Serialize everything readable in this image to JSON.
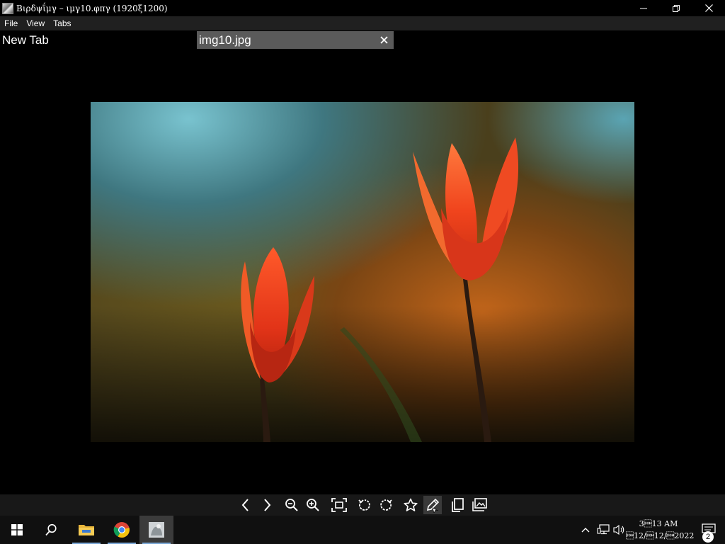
{
  "window": {
    "title": "Βιρδψΐμγ – ιμγ10.φπγ (1920ξ1200)"
  },
  "menu": {
    "items": [
      "File",
      "View",
      "Tabs"
    ]
  },
  "tabs": [
    {
      "label": "New Tab",
      "active": false
    },
    {
      "label": "img10.jpg",
      "active": true
    }
  ],
  "viewer": {
    "image_description_icon": "photo-red-tulips"
  },
  "toolbar": {
    "buttons": [
      {
        "name": "previous-icon"
      },
      {
        "name": "next-icon"
      },
      {
        "name": "zoom-out-icon"
      },
      {
        "name": "zoom-in-icon"
      },
      {
        "name": "fit-to-window-icon"
      },
      {
        "name": "rotate-left-icon"
      },
      {
        "name": "rotate-right-icon"
      },
      {
        "name": "favorite-star-icon"
      },
      {
        "name": "edit-pencil-icon"
      },
      {
        "name": "copy-icon"
      },
      {
        "name": "open-gallery-icon"
      }
    ]
  },
  "taskbar": {
    "apps": [
      "start-icon",
      "search-icon",
      "file-explorer-icon",
      "chrome-icon",
      "image-viewer-icon"
    ],
    "clock_time": "3\u000113 AM",
    "clock_date": "\u000112/\u000112/\u00012022",
    "notification_count": "2"
  },
  "colors": {
    "menubar_bg": "#202020",
    "active_tab_bg": "#5a5a5a",
    "toolbar_bg": "#181818",
    "taskbar_bg": "#101010",
    "accent": "#7aa7d6"
  }
}
